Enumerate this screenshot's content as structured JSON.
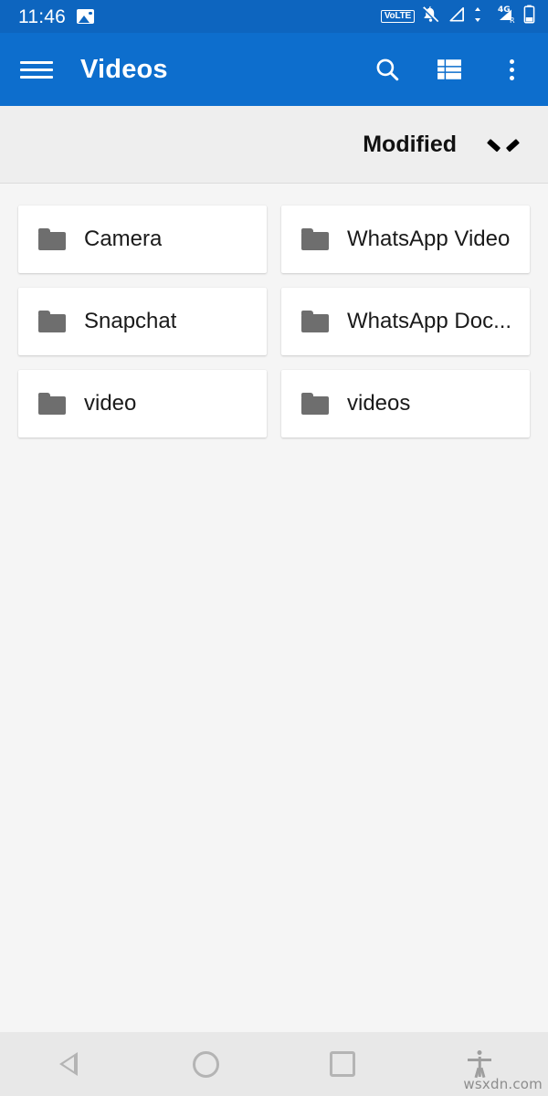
{
  "status_bar": {
    "time": "11:46",
    "left_icons": [
      {
        "name": "photo-icon",
        "label": "photo"
      }
    ],
    "right_icons": [
      {
        "name": "volte-icon",
        "label": "VoLTE"
      },
      {
        "name": "notifications-muted-icon",
        "label": "silent"
      },
      {
        "name": "signal-sim1-icon",
        "label": "signal"
      },
      {
        "name": "mobile-data-4g-icon",
        "label": "4G"
      },
      {
        "name": "signal-roaming-icon",
        "label": "R"
      },
      {
        "name": "battery-icon",
        "label": "battery"
      }
    ],
    "background_color": "#0d65bf"
  },
  "app_bar": {
    "title": "Videos",
    "menu_icon": "hamburger-menu-icon",
    "actions": [
      {
        "name": "search-icon",
        "label": "Search"
      },
      {
        "name": "view-toggle-icon",
        "label": "View mode"
      },
      {
        "name": "overflow-menu-icon",
        "label": "More options"
      }
    ],
    "background_color": "#0d6ecd",
    "title_color": "#ffffff"
  },
  "sort_bar": {
    "label": "Modified",
    "chevron_icon": "chevron-down-icon",
    "background_color": "#eeeeee"
  },
  "content": {
    "background_color": "#f5f5f5",
    "folders": [
      {
        "name": "Camera",
        "icon": "folder-icon"
      },
      {
        "name": "WhatsApp Video",
        "icon": "folder-icon"
      },
      {
        "name": "Snapchat",
        "icon": "folder-icon"
      },
      {
        "name": "WhatsApp Doc...",
        "icon": "folder-icon"
      },
      {
        "name": "video",
        "icon": "folder-icon"
      },
      {
        "name": "videos",
        "icon": "folder-icon"
      }
    ],
    "folder_icon_color": "#6e6e6e",
    "card_color": "#ffffff"
  },
  "nav_bar": {
    "buttons": [
      {
        "name": "nav-back-button",
        "label": "Back"
      },
      {
        "name": "nav-home-button",
        "label": "Home"
      },
      {
        "name": "nav-recents-button",
        "label": "Recents"
      },
      {
        "name": "nav-accessibility-button",
        "label": "Accessibility"
      }
    ],
    "background_color": "#e8e8e8"
  },
  "watermark": {
    "text": "wsxdn.com"
  }
}
